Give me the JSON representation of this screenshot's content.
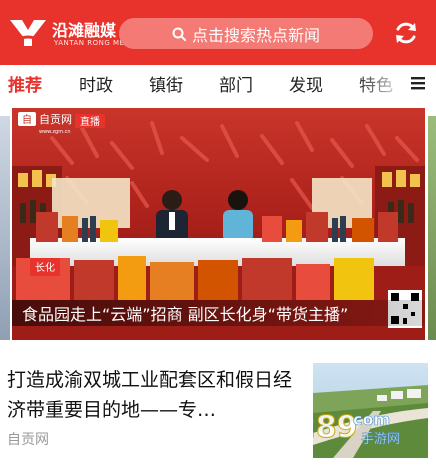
{
  "header": {
    "logo_cn": "沿滩融媒",
    "logo_en": "YANTAN RONG MEI",
    "search_placeholder": "点击搜索热点新闻",
    "colors": {
      "brand": "#e8322c",
      "search_bg": "#f47a75"
    }
  },
  "tabs": [
    {
      "label": "推荐",
      "active": true
    },
    {
      "label": "时政",
      "active": false
    },
    {
      "label": "镇街",
      "active": false
    },
    {
      "label": "部门",
      "active": false
    },
    {
      "label": "发现",
      "active": false
    },
    {
      "label": "特色",
      "active": false
    }
  ],
  "banner": {
    "channel_logo": "自贡网",
    "channel_url": "www.zgm.cn",
    "live_badge": "直播",
    "caption": "食品园走上“云端”招商 副区长化身“带货主播”",
    "stage_sign": "长化"
  },
  "news": {
    "title": "打造成渝双城工业配套区和假日经济带重要目的地——专…",
    "source": "自贡网",
    "watermark_text": "289",
    "watermark_suffix": "com",
    "watermark_sub": "手游网"
  }
}
